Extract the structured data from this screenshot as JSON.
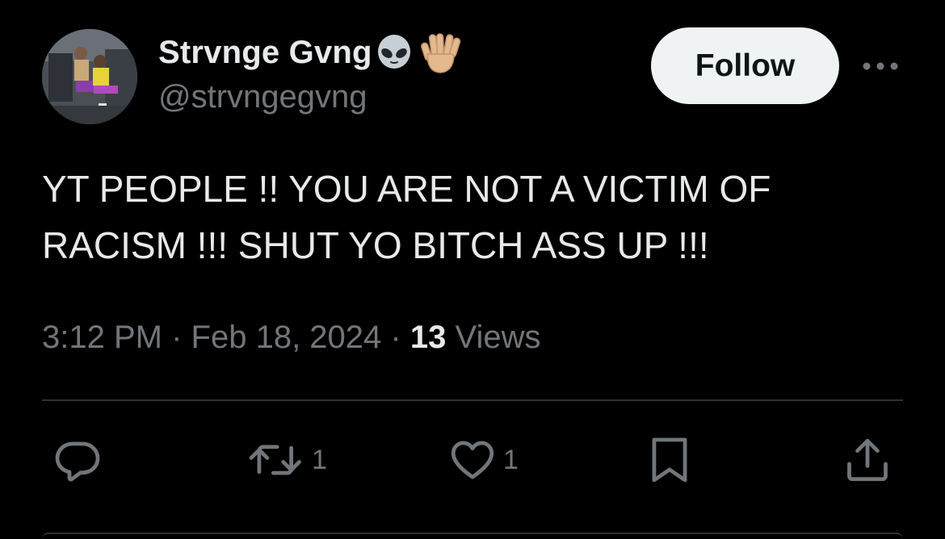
{
  "author": {
    "display_name": "Strvnge Gvng",
    "handle": "@strvngegvng",
    "name_emojis": [
      "alien-emoji",
      "vulcan-salute-emoji"
    ]
  },
  "follow_label": "Follow",
  "more_icon": "more-horizontal-icon",
  "tweet": {
    "lines": [
      "YT PEOPLE !! YOU ARE NOT A VICTIM OF",
      "RACISM !!! SHUT YO BITCH ASS UP !!!"
    ],
    "time": "3:12 PM",
    "separator": "·",
    "date": "Feb 18, 2024",
    "views_count": "13",
    "views_label": "Views"
  },
  "actions": {
    "reply": {
      "icon": "reply-icon",
      "count": ""
    },
    "retweet": {
      "icon": "retweet-icon",
      "count": "1"
    },
    "like": {
      "icon": "heart-icon",
      "count": "1"
    },
    "bookmark": {
      "icon": "bookmark-icon"
    },
    "share": {
      "icon": "share-icon"
    }
  },
  "colors": {
    "background": "#000000",
    "primary_text": "#e7e9ea",
    "secondary_text": "#71767b",
    "divider": "#2f3336",
    "follow_bg": "#eff3f4",
    "follow_text": "#0f1419"
  }
}
